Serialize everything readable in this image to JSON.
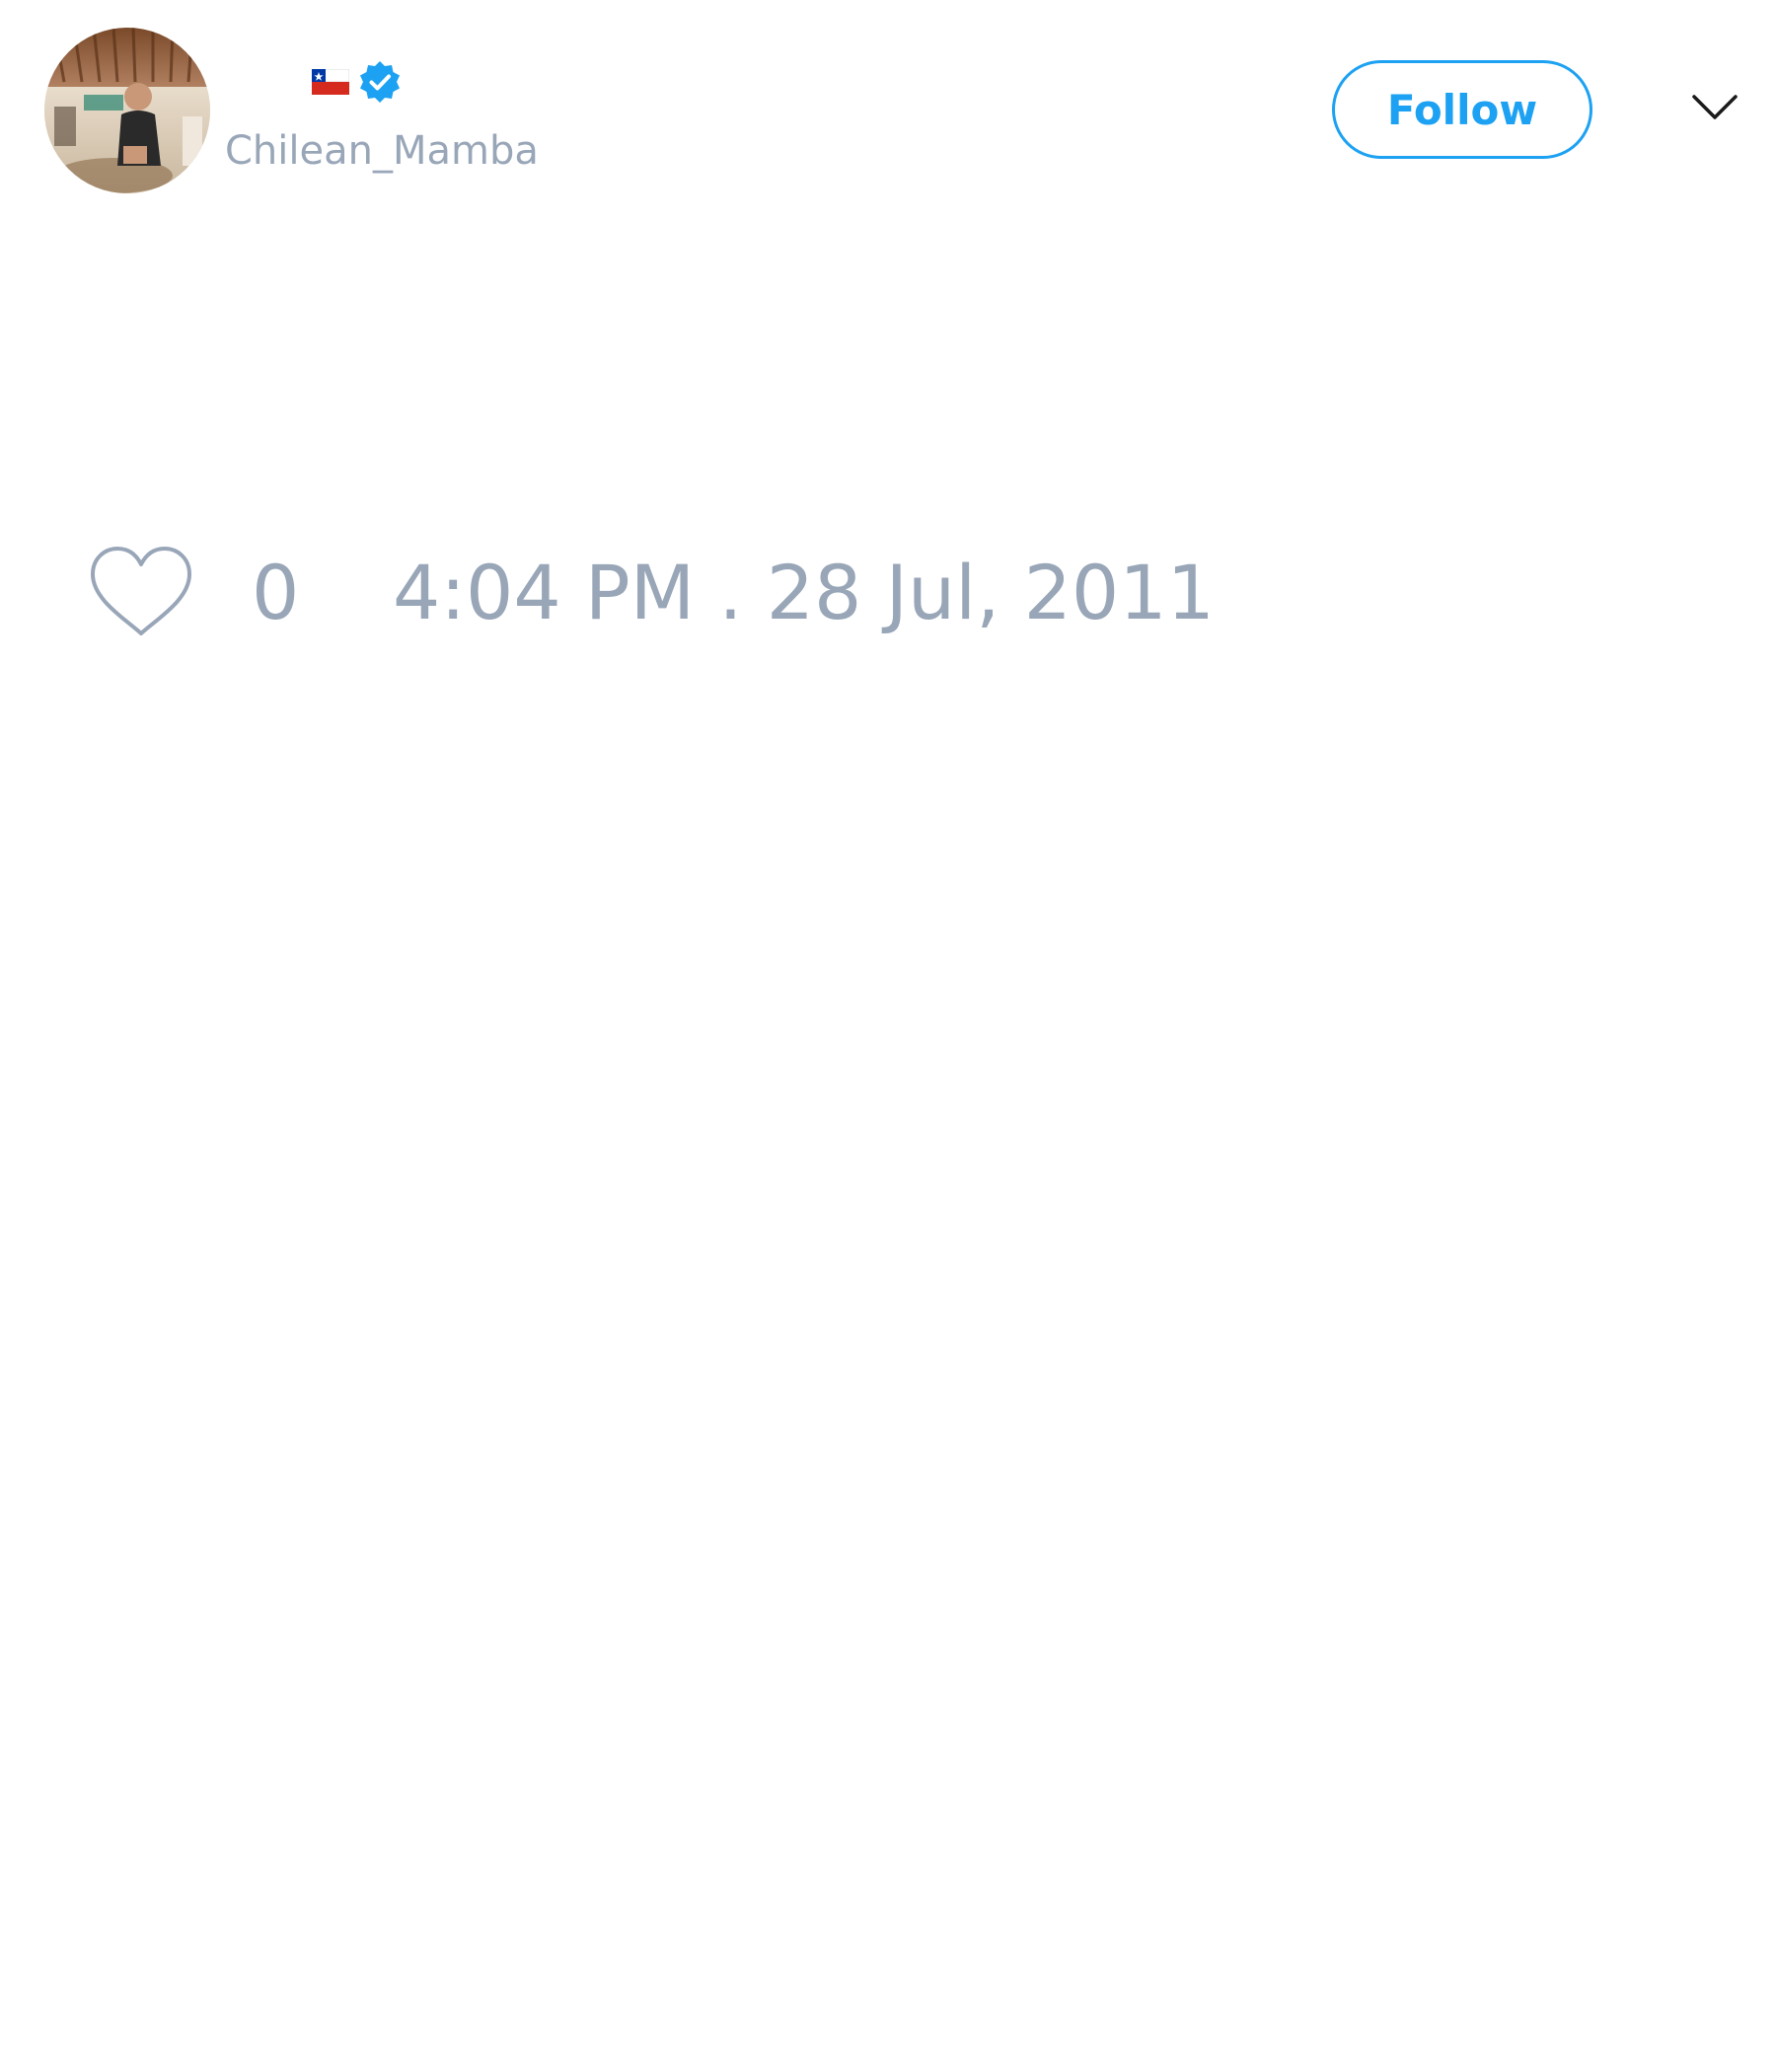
{
  "user": {
    "display_name": "",
    "handle": "Chilean_Mamba",
    "flag_icon": "chile-flag-icon",
    "verified_icon": "verified-badge-icon",
    "avatar_icon": "profile-photo"
  },
  "actions": {
    "follow_label": "Follow",
    "menu_icon": "chevron-down-icon"
  },
  "tweet": {
    "like_icon": "heart-icon",
    "like_count": "0",
    "timestamp": "4:04 PM . 28 Jul, 2011"
  },
  "colors": {
    "accent": "#1da1f2",
    "muted_text": "#98a6b8",
    "background": "#ffffff"
  }
}
